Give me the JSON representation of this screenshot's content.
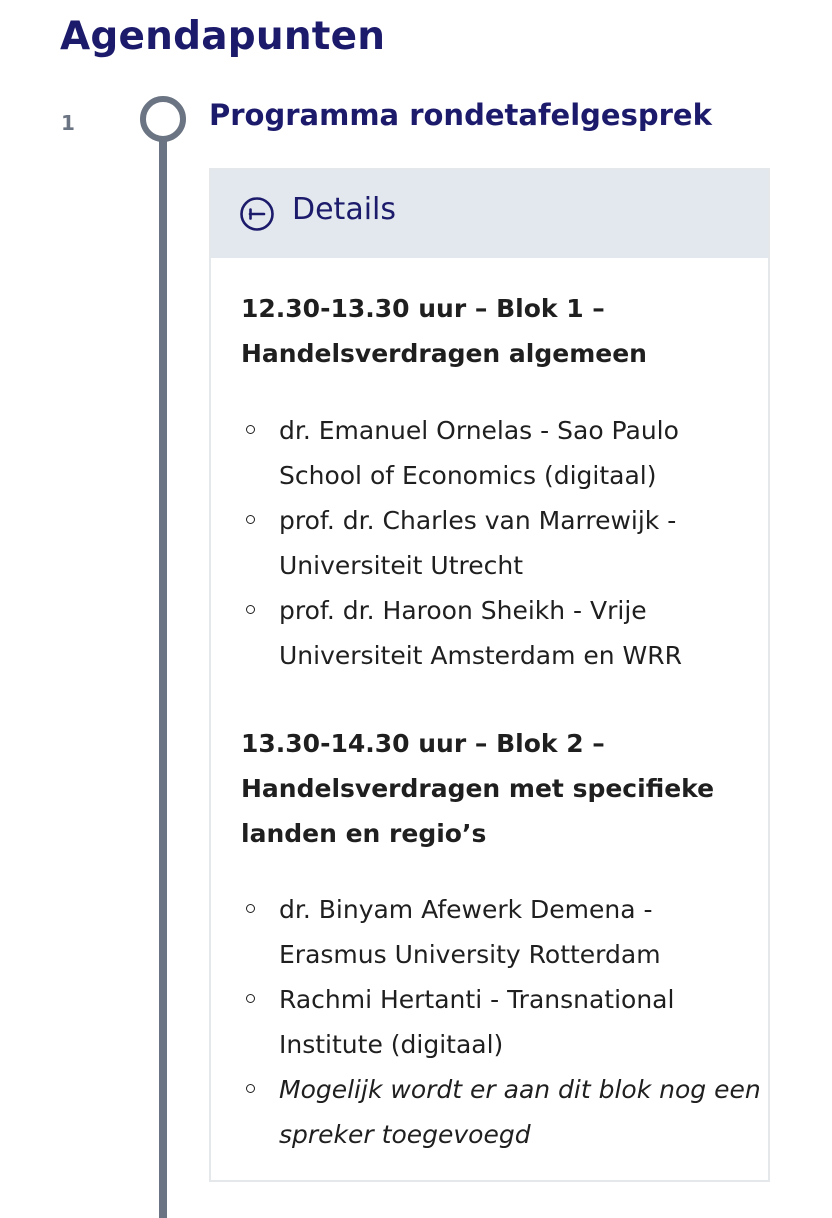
{
  "page_title": "Agendapunten",
  "agenda_item": {
    "number": "1",
    "title": "Programma rondetafelgesprek",
    "details": {
      "toggle_label": "Details",
      "toggle_icon": "collapse-circle-icon",
      "blocks": [
        {
          "title": "12.30-13.30 uur – Blok 1 – Handelsverdragen algemeen",
          "speakers": [
            "dr. Emanuel Ornelas - Sao Paulo School of Economics (digitaal)",
            "prof. dr. Charles van Marrewijk - Universiteit Utrecht",
            "prof. dr. Haroon Sheikh - Vrije Universiteit Amsterdam en WRR"
          ]
        },
        {
          "title": "13.30-14.30 uur – Blok 2 – Handelsverdragen met specifieke landen en regio’s",
          "speakers": [
            "dr. Binyam Afewerk Demena - Erasmus University Rotterdam",
            "Rachmi Hertanti - Transnational Institute (digitaal)",
            "Mogelijk wordt er aan dit blok nog een spreker toegevoegd"
          ]
        }
      ]
    }
  },
  "colors": {
    "heading": "#1c1a6b",
    "timeline": "#6b7482",
    "details_header_bg": "#e2e8ed",
    "panel_border": "#e4e8eb",
    "body_text": "#1f1f1f"
  }
}
